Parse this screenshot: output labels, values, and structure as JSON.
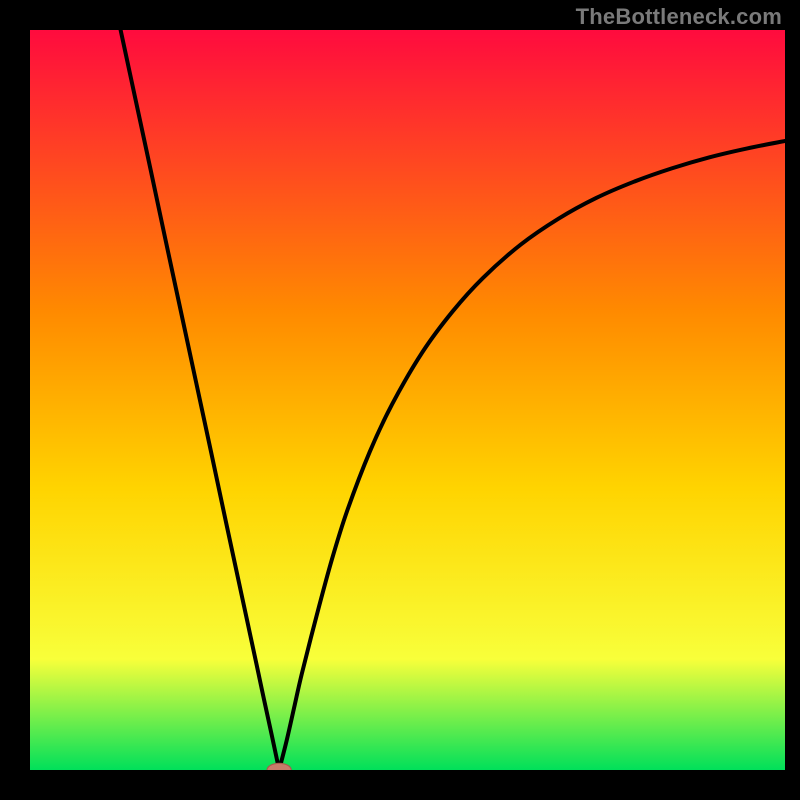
{
  "watermark": {
    "text": "TheBottleneck.com"
  },
  "colors": {
    "black": "#000000",
    "curve": "#000000",
    "marker_fill": "#c77b6a",
    "marker_stroke": "#a85b4b",
    "grad_top": "#ff0b3e",
    "grad_mid1": "#ff8a00",
    "grad_mid2": "#ffd400",
    "grad_mid3": "#f8ff3a",
    "grad_bottom": "#00e05a"
  },
  "chart_data": {
    "type": "line",
    "title": "",
    "xlabel": "",
    "ylabel": "",
    "xlim": [
      0,
      100
    ],
    "ylim": [
      0,
      100
    ],
    "grid": false,
    "legend": null,
    "annotations": [],
    "watermark": "TheBottleneck.com",
    "optimum_x": 33,
    "marker": {
      "x": 33,
      "y": 0,
      "rx": 1.6,
      "ry": 0.9
    },
    "series": [
      {
        "name": "left-branch",
        "x": [
          12,
          14,
          16,
          18,
          20,
          22,
          24,
          26,
          28,
          30,
          31,
          32,
          33
        ],
        "y": [
          100,
          90.5,
          81,
          71.4,
          61.9,
          52.4,
          42.9,
          33.3,
          23.8,
          14.3,
          9.5,
          4.8,
          0
        ]
      },
      {
        "name": "right-branch",
        "x": [
          33,
          34,
          35,
          36,
          38,
          40,
          42,
          45,
          48,
          52,
          56,
          60,
          65,
          70,
          75,
          80,
          85,
          90,
          95,
          100
        ],
        "y": [
          0,
          4.0,
          8.5,
          13.0,
          21.0,
          28.5,
          35.0,
          43.0,
          49.5,
          56.5,
          62.0,
          66.5,
          71.0,
          74.5,
          77.3,
          79.5,
          81.3,
          82.8,
          84.0,
          85.0
        ]
      }
    ]
  }
}
